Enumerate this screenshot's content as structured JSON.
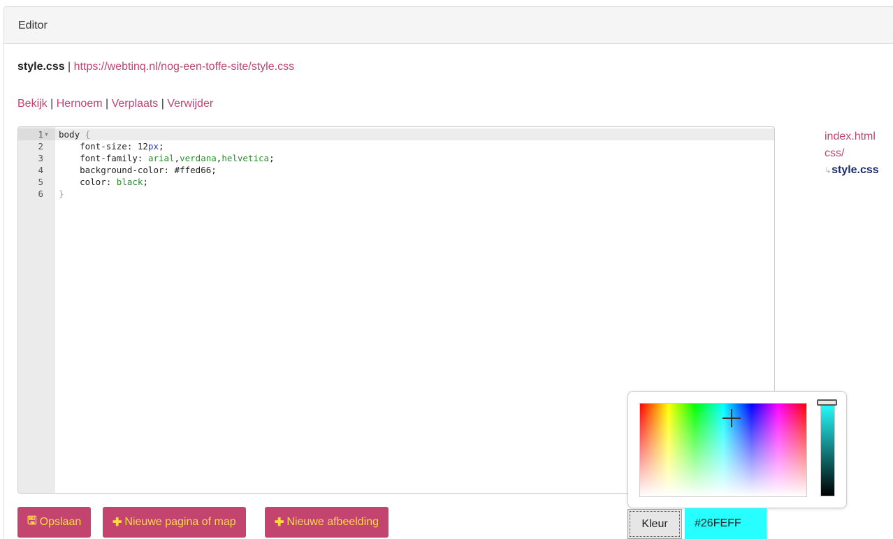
{
  "panel": {
    "title": "Editor"
  },
  "file": {
    "name": "style.css",
    "separator": " | ",
    "url": "https://webtinq.nl/nog-een-toffe-site/style.css"
  },
  "actions": [
    {
      "label": "Bekijk"
    },
    {
      "label": "Hernoem"
    },
    {
      "label": "Verplaats"
    },
    {
      "label": "Verwijder"
    }
  ],
  "editor": {
    "lines": [
      {
        "number": "1",
        "segments": [
          {
            "text": "body ",
            "style": "plain"
          },
          {
            "text": "{",
            "style": "brace"
          }
        ]
      },
      {
        "number": "2",
        "segments": [
          {
            "text": "    font-size: 12",
            "style": "plain"
          },
          {
            "text": "px",
            "style": "blue"
          },
          {
            "text": ";",
            "style": "plain"
          }
        ]
      },
      {
        "number": "3",
        "segments": [
          {
            "text": "    font-family: ",
            "style": "plain"
          },
          {
            "text": "arial",
            "style": "green"
          },
          {
            "text": ",",
            "style": "plain"
          },
          {
            "text": "verdana",
            "style": "green"
          },
          {
            "text": ",",
            "style": "plain"
          },
          {
            "text": "helvetica",
            "style": "green"
          },
          {
            "text": ";",
            "style": "plain"
          }
        ]
      },
      {
        "number": "4",
        "segments": [
          {
            "text": "    background-color: #ffed66;",
            "style": "plain"
          }
        ]
      },
      {
        "number": "5",
        "segments": [
          {
            "text": "    color: ",
            "style": "plain"
          },
          {
            "text": "black",
            "style": "green"
          },
          {
            "text": ";",
            "style": "plain"
          }
        ]
      },
      {
        "number": "6",
        "segments": [
          {
            "text": "}",
            "style": "brace"
          }
        ]
      }
    ]
  },
  "filetree": {
    "items": [
      "index.html",
      "css/"
    ],
    "current_branch": "↳",
    "current": "style.css"
  },
  "buttons": {
    "save": {
      "icon": "floppy-icon",
      "glyph": "🖫",
      "label": "Opslaan"
    },
    "new_page": {
      "icon": "plus-icon",
      "glyph": "✚",
      "label": "Nieuwe pagina of map"
    },
    "new_image": {
      "icon": "plus-icon",
      "glyph": "✚",
      "label": "Nieuwe afbeelding"
    }
  },
  "colorpicker": {
    "button_label": "Kleur",
    "value": "#26FEFF",
    "selected_color": "#26feff"
  },
  "colors": {
    "accent": "#c2446f",
    "button_text": "#ffd94a",
    "current_file": "#1c2a6b"
  }
}
